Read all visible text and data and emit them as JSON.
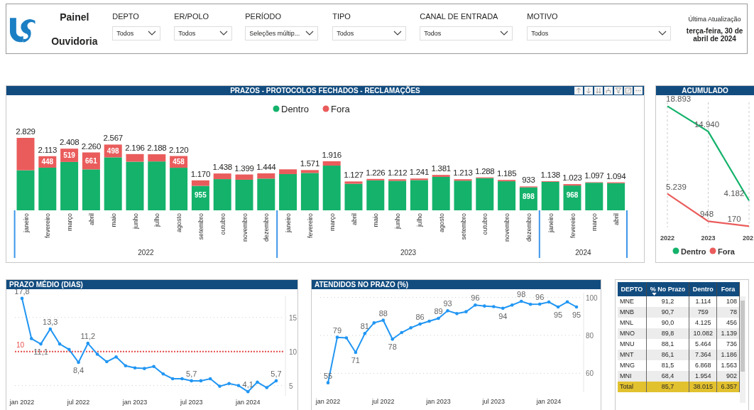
{
  "header": {
    "title_lines": [
      "Painel",
      "Ouvidoria"
    ],
    "filters": [
      {
        "label": "DEPTO",
        "value": "Todos"
      },
      {
        "label": "ER/POLO",
        "value": "Todos"
      },
      {
        "label": "PERÍODO",
        "value": "Seleções múltip..."
      },
      {
        "label": "TIPO",
        "value": "Todos"
      },
      {
        "label": "CANAL DE ENTRADA",
        "value": "Todos"
      },
      {
        "label": "MOTIVO",
        "value": "Todos"
      }
    ],
    "last_update": {
      "label": "Última Atualização",
      "value": "terça-feira, 30 de abril de 2024"
    }
  },
  "prazos_panel": {
    "title": "PRAZOS - PROTOCOLOS FECHADOS - RECLAMAÇÕES",
    "year_groups": [
      {
        "label": "2022"
      },
      {
        "label": "2023"
      },
      {
        "label": "2024"
      }
    ],
    "chart_data": {
      "type": "bar",
      "stacked": true,
      "legend": "top",
      "categories": [
        "janeiro",
        "fevereiro",
        "março",
        "abril",
        "maio",
        "junho",
        "julho",
        "agosto",
        "setembro",
        "outubro",
        "novembro",
        "dezembro",
        "janeiro",
        "fevereiro",
        "março",
        "abril",
        "maio",
        "junho",
        "julho",
        "agosto",
        "setembro",
        "outubro",
        "novembro",
        "dezembro",
        "janeiro",
        "fevereiro",
        "março",
        "abril"
      ],
      "series": [
        {
          "name": "Dentro",
          "color": "#14b26b",
          "values": [
            1564,
            1665,
            1889,
            1599,
            2069,
            1898,
            1908,
            1662,
            955,
            1218,
            1194,
            1239,
            1414,
            1459,
            1746,
            1037,
            1171,
            1152,
            1181,
            1306,
            1158,
            1258,
            1135,
            898,
            1113,
            968,
            1077,
            1059
          ],
          "value_labels": [
            null,
            null,
            null,
            null,
            null,
            null,
            null,
            null,
            "955",
            null,
            null,
            null,
            null,
            null,
            null,
            null,
            null,
            null,
            null,
            null,
            null,
            null,
            null,
            "898",
            null,
            "968",
            null,
            null
          ]
        },
        {
          "name": "Fora",
          "color": "#ea5c5c",
          "values": [
            1265,
            448,
            519,
            661,
            498,
            298,
            280,
            458,
            215,
            220,
            205,
            205,
            186,
            112,
            170,
            90,
            55,
            60,
            60,
            75,
            55,
            30,
            50,
            35,
            25,
            55,
            20,
            35
          ],
          "value_labels": [
            null,
            "448",
            "519",
            "661",
            "498",
            null,
            null,
            "458",
            null,
            null,
            null,
            null,
            null,
            null,
            null,
            null,
            null,
            null,
            null,
            null,
            null,
            null,
            null,
            null,
            null,
            null,
            null,
            null
          ]
        }
      ],
      "annotations": [
        "2.829",
        "2.113",
        "2.408",
        "2.260",
        "2.567",
        "2.196",
        "2.188",
        "2.120",
        "1.170",
        "1.438",
        "1.399",
        "1.444",
        null,
        "1.571",
        "1.916",
        "1.127",
        "1.226",
        "1.212",
        "1.241",
        "1.381",
        "1.213",
        "1.288",
        "1.185",
        "933",
        "1.138",
        "1.023",
        "1.097",
        "1.094"
      ]
    }
  },
  "acumulado_panel": {
    "title": "ACUMULADO",
    "chart_data": {
      "type": "line",
      "legend": "bottom",
      "grid": true,
      "categories": [
        "2022",
        "2023",
        "202"
      ],
      "series": [
        {
          "name": "Dentro",
          "color": "#14b26b",
          "values": [
            18893,
            14940,
            4182
          ],
          "value_labels": [
            "18.893",
            "14.940",
            "4.182"
          ]
        },
        {
          "name": "Fora",
          "color": "#ea5c5c",
          "values": [
            5239,
            948,
            170
          ],
          "value_labels": [
            "5.239",
            "948",
            "170"
          ]
        }
      ]
    }
  },
  "prazo_medio_panel": {
    "title": "PRAZO MÉDIO (DIAS)",
    "chart_data": {
      "type": "line",
      "grid": true,
      "categories": [
        "jan 2022",
        null,
        null,
        null,
        null,
        null,
        "jul 2022",
        null,
        null,
        null,
        null,
        null,
        "jan 2023",
        null,
        null,
        null,
        null,
        null,
        "jul 2023",
        null,
        null,
        null,
        null,
        null,
        "jan 2024",
        null,
        null,
        null
      ],
      "series": [
        {
          "color": "#2196f3",
          "values": [
            17.8,
            11.9,
            11.1,
            13.3,
            11.1,
            10.3,
            8.4,
            11.2,
            9.6,
            8.5,
            9.2,
            7.9,
            7.6,
            7.5,
            7.8,
            6.7,
            6.0,
            6.0,
            5.7,
            5.7,
            6.0,
            4.9,
            5.3,
            5.0,
            4.1,
            5.5,
            4.7,
            5.7
          ],
          "value_labels": [
            "17,8",
            null,
            "11,1",
            "13,3",
            null,
            null,
            "8,4",
            "11,2",
            null,
            null,
            null,
            null,
            null,
            null,
            null,
            null,
            null,
            null,
            "5,7",
            null,
            null,
            null,
            null,
            null,
            "4,1",
            null,
            null,
            "5,7"
          ]
        }
      ],
      "ylim": [
        3.5,
        18.1
      ],
      "yticks": [
        5,
        10,
        15
      ],
      "ref_lines": [
        {
          "axis": "y",
          "value": 10,
          "label": "10",
          "color": "#e84c4c"
        }
      ]
    }
  },
  "atendidos_panel": {
    "title": "ATENDIDOS NO PRAZO (%)",
    "chart_data": {
      "type": "line",
      "grid": true,
      "categories": [
        "jan 2022",
        null,
        null,
        null,
        null,
        null,
        "jul 2022",
        null,
        null,
        null,
        null,
        null,
        "jan 2023",
        null,
        null,
        null,
        null,
        null,
        "jul 2023",
        null,
        null,
        null,
        null,
        null,
        "jan 2024",
        null,
        null,
        null
      ],
      "series": [
        {
          "color": "#2196f3",
          "values": [
            55,
            79,
            78.7,
            71,
            81,
            86.6,
            88,
            78,
            81.5,
            84,
            86,
            87.5,
            89,
            93,
            91.5,
            92.5,
            96,
            95.5,
            95.2,
            94.3,
            96,
            98,
            96.4,
            96.5,
            97.6,
            95,
            97.7,
            95
          ],
          "value_labels": [
            "55",
            "79",
            null,
            "71",
            "81",
            null,
            "88",
            "78",
            null,
            null,
            "86",
            null,
            "89",
            "93",
            null,
            null,
            "96",
            null,
            null,
            "94",
            null,
            "98",
            null,
            "96",
            null,
            "95",
            null,
            "95"
          ]
        }
      ],
      "ylim": [
        50,
        102.5
      ],
      "yticks": [
        60,
        80,
        100
      ]
    }
  },
  "table": {
    "columns": [
      {
        "label": "DEPTO",
        "sorted": false
      },
      {
        "label": "% No Prazo",
        "sorted": true
      },
      {
        "label": "Dentro",
        "sorted": false
      },
      {
        "label": "Fora",
        "sorted": false
      }
    ],
    "rows": [
      [
        "MNE",
        "91,2",
        "1.114",
        "108"
      ],
      [
        "MNB",
        "90,7",
        "759",
        "78"
      ],
      [
        "MNL",
        "90,0",
        "4.125",
        "456"
      ],
      [
        "MNO",
        "89,8",
        "10.082",
        "1.139"
      ],
      [
        "MNU",
        "88,1",
        "5.464",
        "736"
      ],
      [
        "MNT",
        "86,1",
        "7.364",
        "1.186"
      ],
      [
        "MNG",
        "81,5",
        "6.868",
        "1.563"
      ],
      [
        "MNI",
        "68,4",
        "1.954",
        "902"
      ]
    ],
    "total": [
      "Total",
      "85,7",
      "38.015",
      "6.357"
    ]
  }
}
